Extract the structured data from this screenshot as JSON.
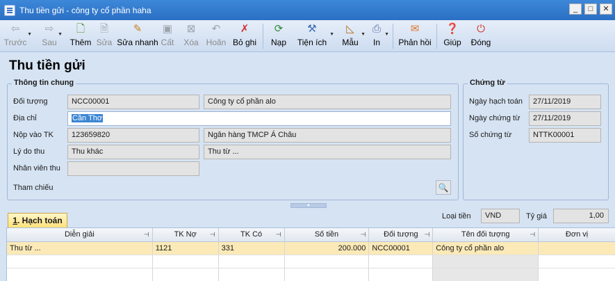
{
  "window": {
    "title": "Thu tiền gửi - công ty cổ phần haha",
    "buttons": {
      "minimize": "_",
      "maximize": "□",
      "close": "✕"
    }
  },
  "toolbar": {
    "back": {
      "label": "Trước",
      "icon": "arrow-left-icon"
    },
    "next": {
      "label": "Sau",
      "icon": "arrow-right-icon"
    },
    "add": {
      "label": "Thêm",
      "icon": "add-document-icon"
    },
    "edit": {
      "label": "Sửa",
      "icon": "edit-document-icon"
    },
    "quick_edit": {
      "label": "Sửa nhanh",
      "icon": "pencil-icon"
    },
    "save": {
      "label": "Cất",
      "icon": "floppy-disk-icon"
    },
    "delete": {
      "label": "Xóa",
      "icon": "delete-document-icon"
    },
    "undo": {
      "label": "Hoãn",
      "icon": "undo-icon"
    },
    "unpost": {
      "label": "Bỏ ghi",
      "icon": "unpost-icon"
    },
    "reload": {
      "label": "Nạp",
      "icon": "refresh-icon"
    },
    "utilities": {
      "label": "Tiện ích",
      "icon": "tools-icon"
    },
    "template": {
      "label": "Mẫu",
      "icon": "template-icon"
    },
    "print": {
      "label": "In",
      "icon": "printer-icon"
    },
    "feedback": {
      "label": "Phản hồi",
      "icon": "envelope-icon"
    },
    "help": {
      "label": "Giúp",
      "icon": "help-icon"
    },
    "close": {
      "label": "Đóng",
      "icon": "power-icon"
    }
  },
  "form": {
    "title": "Thu tiền gửi",
    "general_info": {
      "legend": "Thông tin chung",
      "object_label": "Đối tượng",
      "object_code": "NCC00001",
      "object_name": "Công ty cổ phần alo",
      "address_label": "Địa chỉ",
      "address_value": "Cần Thơ",
      "deposit_label": "Nộp vào TK",
      "account_number": "123659820",
      "bank_name": "Ngân hàng TMCP Á Châu",
      "reason_label": "Lý do thu",
      "reason_value": "Thu khác",
      "reason_detail": "Thu từ ...",
      "employee_label": "Nhân viên thu",
      "employee_value": "",
      "reference_label": "Tham chiếu"
    },
    "voucher": {
      "legend": "Chứng từ",
      "posting_date_label": "Ngày hạch toán",
      "posting_date": "27/11/2019",
      "voucher_date_label": "Ngày chứng từ",
      "voucher_date": "27/11/2019",
      "voucher_no_label": "Số chứng từ",
      "voucher_no": "NTTK00001"
    },
    "currency": {
      "label": "Loại tiền",
      "value": "VND",
      "rate_label": "Tỷ giá",
      "rate_value": "1,00"
    }
  },
  "tabs": [
    {
      "key": "1",
      "label": ". Hạch toán"
    }
  ],
  "grid": {
    "columns": [
      "Diễn giải",
      "TK Nợ",
      "TK Có",
      "Số tiền",
      "Đối tượng",
      "Tên đối tượng",
      "Đơn vị"
    ],
    "rows": [
      {
        "description": "Thu từ ...",
        "debit": "1121",
        "credit": "331",
        "amount": "200.000",
        "object": "NCC00001",
        "object_name": "Công ty cổ phần alo",
        "unit": ""
      }
    ]
  }
}
